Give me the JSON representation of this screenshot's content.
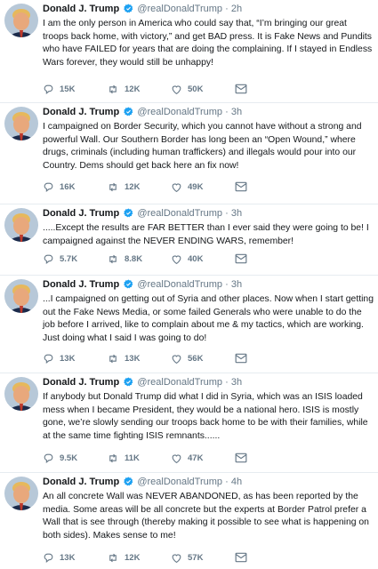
{
  "account": {
    "name": "Donald J. Trump",
    "handle": "@realDonaldTrump",
    "separator": "·"
  },
  "colors": {
    "text": "#14171a",
    "muted": "#657786",
    "verified": "#1da1f2",
    "divider": "#e6ecf0"
  },
  "icons": [
    "verified-badge-icon",
    "reply-icon",
    "retweet-icon",
    "like-icon",
    "message-icon"
  ],
  "tweets": [
    {
      "time": "2h",
      "text": "I am the only person in America who could say that, “I’m bringing our great troops back home, with victory,” and get BAD press. It is Fake News and Pundits who have FAILED for years that are doing the complaining. If I stayed in Endless Wars forever, they would still be unhappy!",
      "replies": "15K",
      "retweets": "12K",
      "likes": "50K"
    },
    {
      "time": "3h",
      "text": "I campaigned on Border Security, which you cannot have without a strong and powerful Wall. Our Southern Border has long been an “Open Wound,” where drugs, criminals (including human traffickers) and illegals would pour into our Country. Dems should get back here an fix now!",
      "replies": "16K",
      "retweets": "12K",
      "likes": "49K"
    },
    {
      "time": "3h",
      "text": ".....Except the results are FAR BETTER than I ever said they were going to be! I campaigned against the NEVER ENDING WARS, remember!",
      "replies": "5.7K",
      "retweets": "8.8K",
      "likes": "40K"
    },
    {
      "time": "3h",
      "text": "...I campaigned on getting out of Syria and other places. Now when I start getting out the Fake News Media, or some failed Generals who were unable to do the job before I arrived, like to complain about me & my tactics, which are working. Just doing what I said I was going to do!",
      "replies": "13K",
      "retweets": "13K",
      "likes": "56K"
    },
    {
      "time": "3h",
      "text": "If anybody but Donald Trump did what I did in Syria, which was an ISIS loaded mess when I became President, they would be a national hero. ISIS is mostly gone, we’re slowly sending our troops back home to be with their families, while at the same time fighting ISIS remnants......",
      "replies": "9.5K",
      "retweets": "11K",
      "likes": "47K"
    },
    {
      "time": "4h",
      "text": "An all concrete Wall was NEVER ABANDONED, as has been reported by the media. Some areas will be all concrete but the experts at Border Patrol prefer a Wall that is see through (thereby making it possible to see what is happening on both sides). Makes sense to me!",
      "replies": "13K",
      "retweets": "12K",
      "likes": "57K"
    }
  ]
}
